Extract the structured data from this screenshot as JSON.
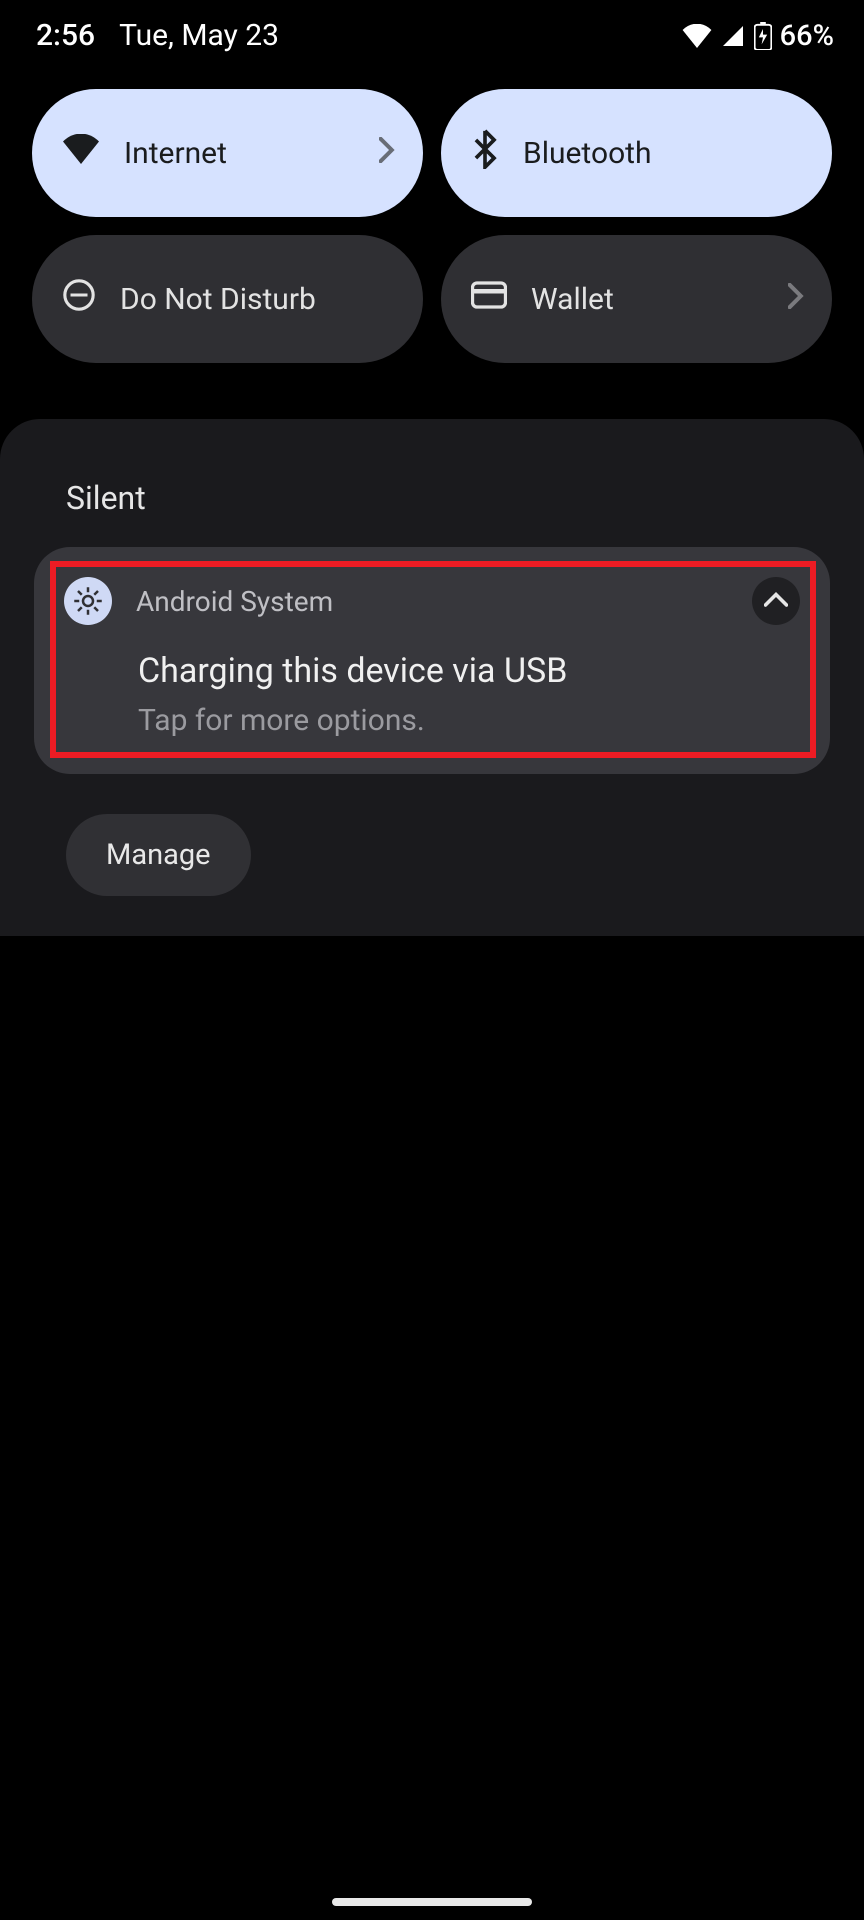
{
  "status": {
    "time": "2:56",
    "date": "Tue, May 23",
    "battery_pct": "66%"
  },
  "tiles": {
    "internet": "Internet",
    "bluetooth": "Bluetooth",
    "dnd": "Do Not Disturb",
    "wallet": "Wallet"
  },
  "notifications": {
    "section_label": "Silent",
    "items": [
      {
        "app": "Android System",
        "title": "Charging this device via USB",
        "body": "Tap for more options."
      }
    ],
    "manage_label": "Manage"
  }
}
